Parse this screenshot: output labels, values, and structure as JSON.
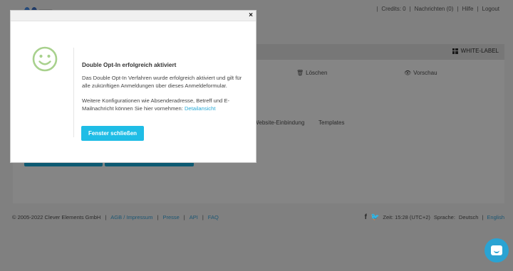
{
  "header": {
    "credits_label": "Credits: 0",
    "messages_label": "Nachrichten (0)",
    "help_label": "Hilfe",
    "logout_label": "Logout"
  },
  "card": {
    "white_label": "WHITE-LABEL",
    "delete_label": "Löschen",
    "preview_label": "Vorschau",
    "tabs": [
      {
        "label": "Website-Einbindung"
      },
      {
        "label": "Templates"
      }
    ]
  },
  "footer": {
    "copyright": "© 2005-2022 Clever Elements GmbH",
    "links": [
      {
        "label": "AGB / Impressum"
      },
      {
        "label": "Presse"
      },
      {
        "label": "API"
      },
      {
        "label": "FAQ"
      }
    ],
    "time_label": "Zeit: 15:28 (UTC+2)",
    "language_label": "Sprache:",
    "language_de": "Deutsch",
    "language_en": "English"
  },
  "modal": {
    "close_glyph": "×",
    "title": "Double Opt-In erfolgreich aktiviert",
    "paragraph1": "Das Double Opt-In Verfahren wurde erfolgreich aktiviert und gilt für alle zukünftigen Anmeldungen über dieses Anmeldeformular.",
    "paragraph2_text": "Weitere Konfigurationen wie Absenderadresse, Betreff und E-Mailnachricht können Sie hier vornehmen:",
    "paragraph2_link": "Detailansicht",
    "close_button": "Fenster schließen"
  },
  "colors": {
    "accent": "#1fbde6",
    "smiley": "#a8d18d",
    "overlay": "#808080"
  }
}
